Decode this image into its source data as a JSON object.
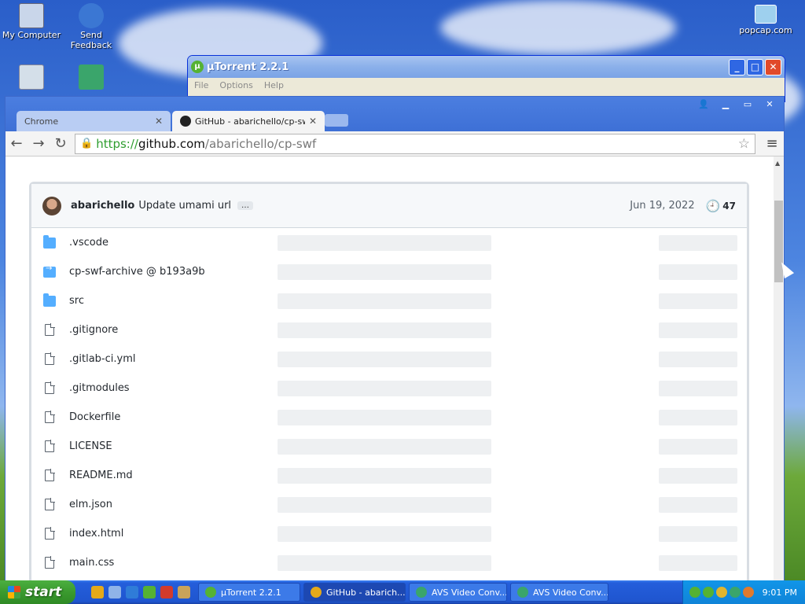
{
  "desktop": {
    "icons": [
      {
        "label": "My Computer",
        "icon": "computer-icon"
      },
      {
        "label": "Send Feedback",
        "icon": "feedback-icon"
      },
      {
        "label": "popcap.com",
        "icon": "shortcut-icon"
      }
    ]
  },
  "utorrent": {
    "title": "µTorrent 2.2.1",
    "menu": [
      "File",
      "Options",
      "Help"
    ]
  },
  "chrome": {
    "tabs": [
      {
        "label": "Chrome",
        "close": "✕"
      },
      {
        "label": "GitHub - abarichello/cp-swf",
        "close": "✕"
      }
    ],
    "url": {
      "scheme": "https://",
      "host": "github.com",
      "path": "/abarichello/cp-swf"
    }
  },
  "commit": {
    "author": "abarichello",
    "message": "Update umami url",
    "ellipsis": "…",
    "date": "Jun 19, 2022",
    "count": "47"
  },
  "files": [
    {
      "name": ".vscode",
      "type": "folder"
    },
    {
      "name": "cp-swf-archive @ b193a9b",
      "type": "submodule"
    },
    {
      "name": "src",
      "type": "folder"
    },
    {
      "name": ".gitignore",
      "type": "file"
    },
    {
      "name": ".gitlab-ci.yml",
      "type": "file"
    },
    {
      "name": ".gitmodules",
      "type": "file"
    },
    {
      "name": "Dockerfile",
      "type": "file"
    },
    {
      "name": "LICENSE",
      "type": "file"
    },
    {
      "name": "README.md",
      "type": "file"
    },
    {
      "name": "elm.json",
      "type": "file"
    },
    {
      "name": "index.html",
      "type": "file"
    },
    {
      "name": "main.css",
      "type": "file"
    }
  ],
  "taskbar": {
    "start": "start",
    "buttons": [
      {
        "label": "µTorrent 2.2.1",
        "color": "#55b233"
      },
      {
        "label": "GitHub - abarich...",
        "color": "#e5a91a"
      },
      {
        "label": "AVS Video Conv...",
        "color": "#3aa56b"
      },
      {
        "label": "AVS Video Conv...",
        "color": "#3aa56b"
      }
    ],
    "clock": "9:01 PM"
  }
}
